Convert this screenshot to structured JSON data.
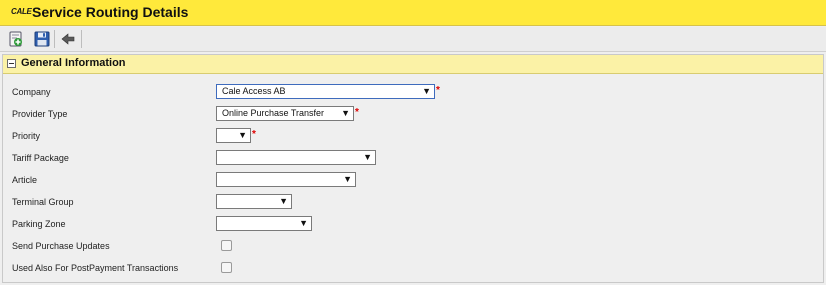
{
  "header": {
    "logo_text": "CALE",
    "title": "Service Routing Details"
  },
  "toolbar": {
    "buttons": [
      {
        "icon": "add-new-icon"
      },
      {
        "icon": "save-icon"
      },
      {
        "icon": "back-arrow-icon"
      }
    ]
  },
  "section": {
    "title": "General Information"
  },
  "form": {
    "company": {
      "label": "Company",
      "value": "Cale Access AB",
      "required": true
    },
    "provider_type": {
      "label": "Provider Type",
      "value": "Online Purchase Transfer",
      "required": true
    },
    "priority": {
      "label": "Priority",
      "value": "",
      "required": true
    },
    "tariff_package": {
      "label": "Tariff Package",
      "value": ""
    },
    "article": {
      "label": "Article",
      "value": ""
    },
    "terminal_group": {
      "label": "Terminal Group",
      "value": ""
    },
    "parking_zone": {
      "label": "Parking Zone",
      "value": ""
    },
    "send_purchase_updates": {
      "label": "Send Purchase Updates",
      "checked": false
    },
    "used_also_postpayment": {
      "label": "Used Also For PostPayment Transactions",
      "checked": false
    }
  },
  "symbols": {
    "dropdown_arrow": "▼",
    "required_marker": "*"
  },
  "colors": {
    "title_bar": "#ffe93b",
    "section_header": "#fbf2a6",
    "required": "#dd0000"
  }
}
